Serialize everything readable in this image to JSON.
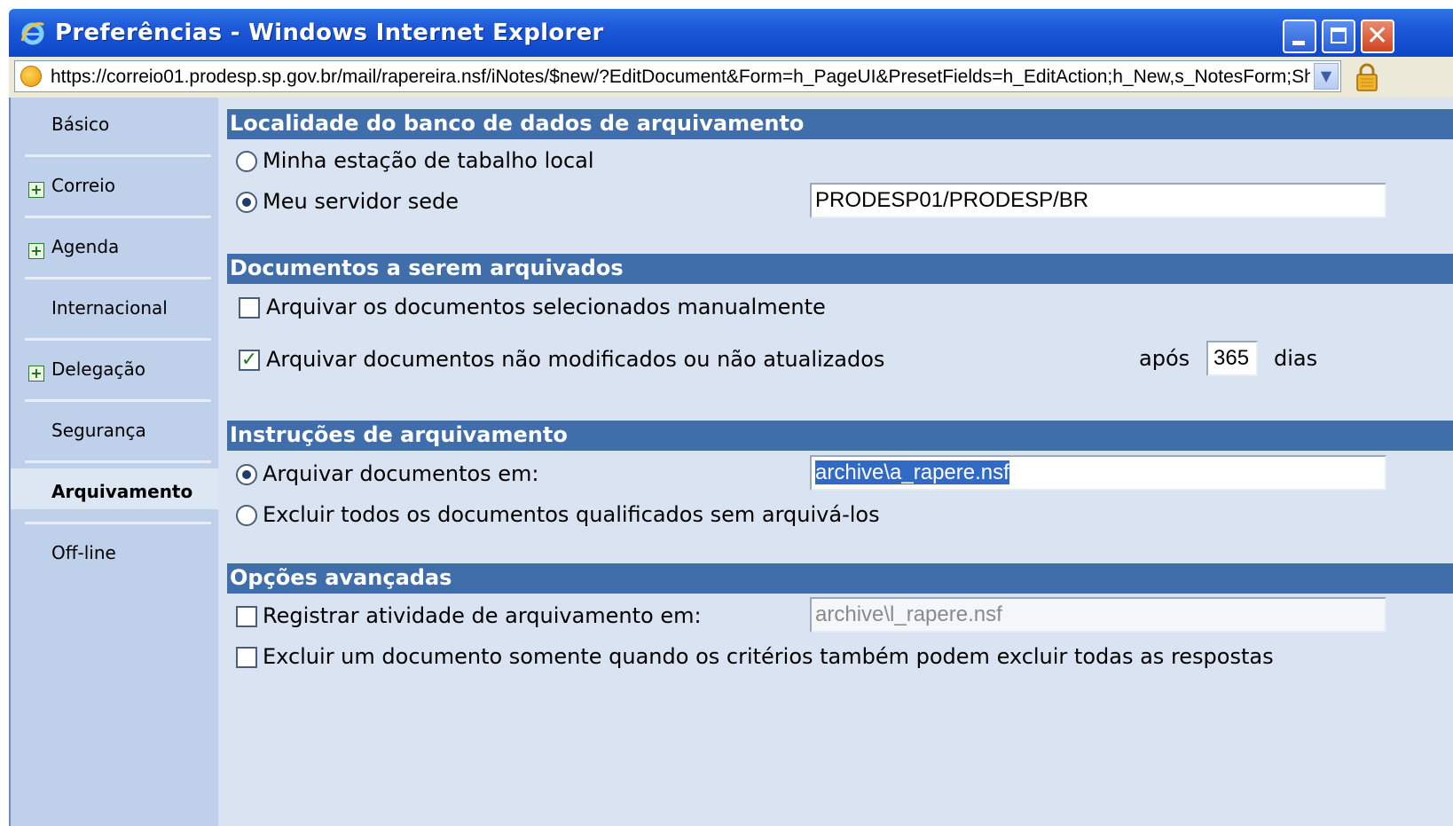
{
  "window": {
    "title": "Preferências - Windows Internet Explorer",
    "url": "https://correio01.prodesp.sp.gov.br/mail/rapereira.nsf/iNotes/$new/?EditDocument&Form=h_PageUI&PresetFields=h_EditAction;h_New,s_NotesForm;Sh"
  },
  "sidebar": {
    "items": [
      {
        "label": "Básico",
        "expandable": false
      },
      {
        "label": "Correio",
        "expandable": true
      },
      {
        "label": "Agenda",
        "expandable": true
      },
      {
        "label": "Internacional",
        "expandable": false
      },
      {
        "label": "Delegação",
        "expandable": true
      },
      {
        "label": "Segurança",
        "expandable": false
      },
      {
        "label": "Arquivamento",
        "expandable": false,
        "active": true
      },
      {
        "label": "Off-line",
        "expandable": false
      }
    ]
  },
  "sections": {
    "location": {
      "header": "Localidade do banco de dados de arquivamento",
      "opt_local": "Minha estação de tabalho local",
      "opt_server": "Meu servidor sede",
      "server_value": "PRODESP01/PRODESP/BR",
      "selected": "server"
    },
    "documents": {
      "header": "Documentos a serem arquivados",
      "manual_label": "Arquivar os documentos selecionados manualmente",
      "manual_checked": false,
      "unmodified_label": "Arquivar documentos não modificados ou não atualizados",
      "unmodified_checked": true,
      "after_label": "após",
      "days_value": "365",
      "days_label": "dias"
    },
    "instructions": {
      "header": "Instruções de arquivamento",
      "opt_archive": "Arquivar documentos em:",
      "archive_value": "archive\\a_rapere.nsf",
      "opt_delete": "Excluir todos os documentos qualificados sem arquivá-los",
      "selected": "archive"
    },
    "advanced": {
      "header": "Opções avançadas",
      "log_label": "Registrar atividade de arquivamento em:",
      "log_value": "archive\\l_rapere.nsf",
      "log_checked": false,
      "replies_label": "Excluir um documento somente quando os critérios também podem excluir todas as respostas",
      "replies_checked": false
    }
  },
  "colors": {
    "titlebar": "#0c47c8",
    "section_header": "#3f6eaa",
    "panel_bg": "#d9e3f1",
    "sidebar_bg": "#bfd1ea"
  }
}
